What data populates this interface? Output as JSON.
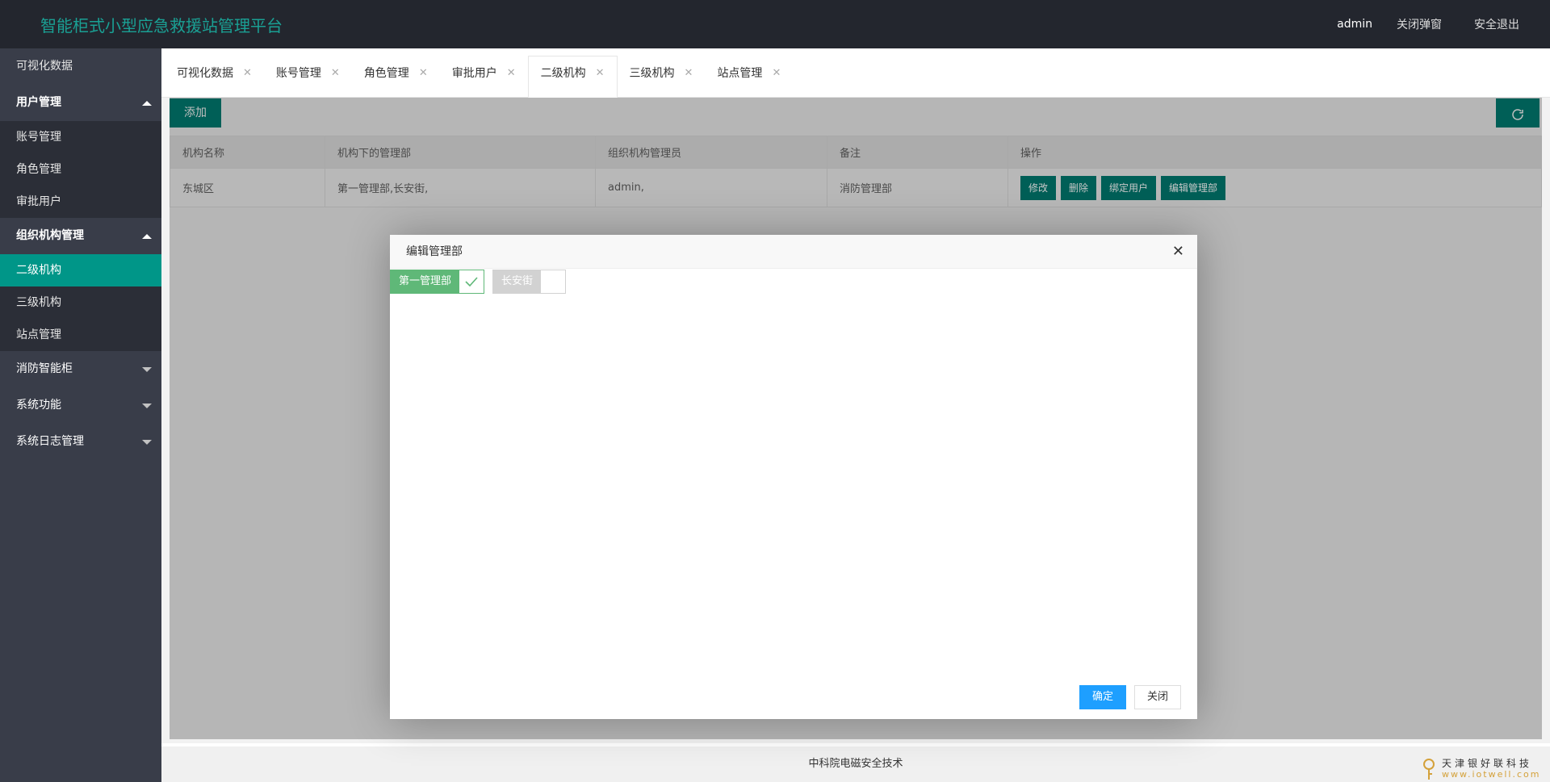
{
  "header": {
    "app_title": "智能柜式小型应急救援站管理平台",
    "user": "admin",
    "close_popup": "关闭弹窗",
    "logout": "安全退出"
  },
  "sidebar": {
    "visual_data": "可视化数据",
    "user_mgmt": {
      "label": "用户管理",
      "items": [
        "账号管理",
        "角色管理",
        "审批用户"
      ]
    },
    "org_mgmt": {
      "label": "组织机构管理",
      "items": [
        "二级机构",
        "三级机构",
        "站点管理"
      ]
    },
    "fire_cabinet": "消防智能柜",
    "system_functions": "系统功能",
    "system_logs": "系统日志管理"
  },
  "tabs": [
    "可视化数据",
    "账号管理",
    "角色管理",
    "审批用户",
    "二级机构",
    "三级机构",
    "站点管理"
  ],
  "toolbar": {
    "add_label": "添加",
    "refresh_icon": "refresh-icon"
  },
  "table": {
    "headers": [
      "机构名称",
      "机构下的管理部",
      "组织机构管理员",
      "备注",
      "操作"
    ],
    "rows": [
      {
        "name": "东城区",
        "departments": "第一管理部,长安街,",
        "admins": "admin,",
        "remark": "消防管理部",
        "actions": [
          "修改",
          "删除",
          "绑定用户",
          "编辑管理部"
        ]
      }
    ]
  },
  "modal": {
    "title": "编辑管理部",
    "options": [
      {
        "label": "第一管理部",
        "checked": true
      },
      {
        "label": "长安街",
        "checked": false
      }
    ],
    "confirm": "确定",
    "close": "关闭"
  },
  "footer": {
    "text": "中科院电磁安全技术"
  },
  "watermark": {
    "name": "天津银好联科技",
    "url": "www.iotwell.com"
  },
  "colors": {
    "topbar": "#23262e",
    "sidebar": "#393d49",
    "active": "#009688",
    "title": "#1aa094",
    "check_on": "#5fb878",
    "primary_button": "#1e9fff"
  }
}
